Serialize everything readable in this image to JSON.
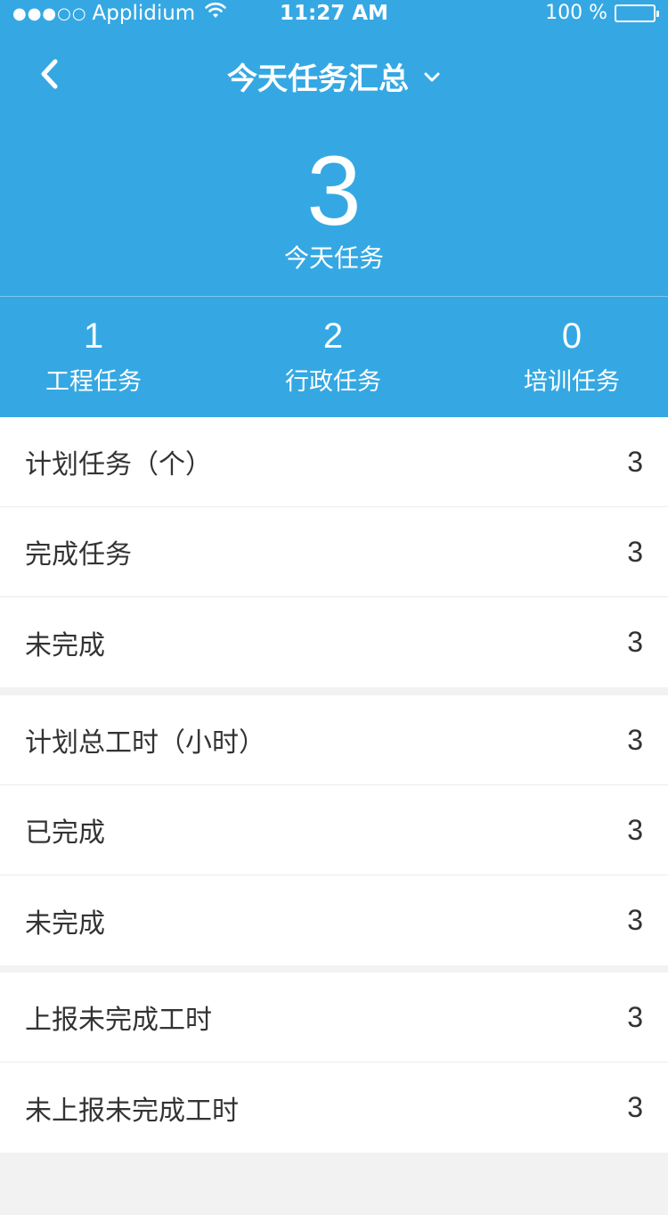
{
  "status_bar": {
    "signal_dots": "●●●○○",
    "carrier": "Applidium",
    "time": "11:27 AM",
    "battery": "100 %"
  },
  "nav": {
    "back_icon": "chevron-left-icon",
    "title": "今天任务汇总",
    "title_icon": "chevron-down-icon"
  },
  "summary": {
    "total_value": "3",
    "total_label": "今天任务",
    "stats": [
      {
        "value": "1",
        "label": "工程任务"
      },
      {
        "value": "2",
        "label": "行政任务"
      },
      {
        "value": "0",
        "label": "培训任务"
      }
    ]
  },
  "groups": [
    {
      "rows": [
        {
          "label": "计划任务（个）",
          "value": "3"
        },
        {
          "label": "完成任务",
          "value": "3"
        },
        {
          "label": "未完成",
          "value": "3"
        }
      ]
    },
    {
      "rows": [
        {
          "label": "计划总工时（小时）",
          "value": "3"
        },
        {
          "label": "已完成",
          "value": "3"
        },
        {
          "label": "未完成",
          "value": "3"
        }
      ]
    },
    {
      "rows": [
        {
          "label": "上报未完成工时",
          "value": "3"
        },
        {
          "label": "未上报未完成工时",
          "value": "3"
        }
      ]
    }
  ],
  "colors": {
    "header_bg": "#35a8e3",
    "page_bg": "#f2f2f2",
    "text": "#333333"
  }
}
